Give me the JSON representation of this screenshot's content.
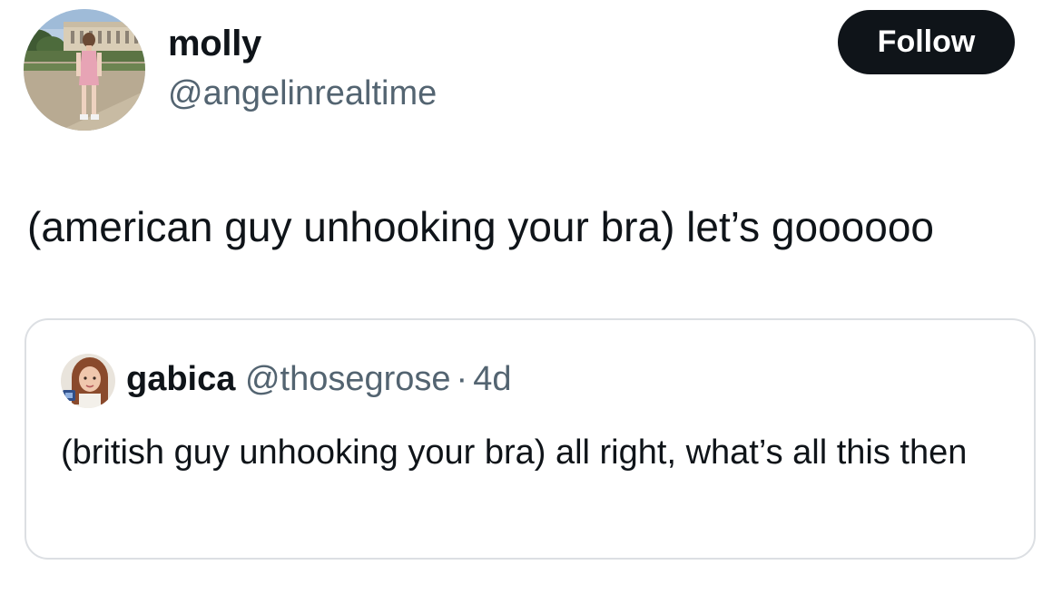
{
  "author": {
    "display_name": "molly",
    "handle": "@angelinrealtime",
    "avatar_icon": "profile-photo-person-in-garden"
  },
  "follow_button": {
    "label": "Follow",
    "background": "#0f1419",
    "text_color": "#ffffff"
  },
  "tweet": {
    "text": "(american guy unhooking your bra) let’s goooooo"
  },
  "quoted_tweet": {
    "display_name": "gabica",
    "handle": "@thosegrose",
    "separator": "·",
    "time": "4d",
    "text": "(british guy unhooking your bra) all right, what’s all this then",
    "avatar_icon": "profile-photo-person"
  },
  "colors": {
    "text_primary": "#0f1419",
    "text_secondary": "#536471",
    "border": "#dcdfe3"
  }
}
